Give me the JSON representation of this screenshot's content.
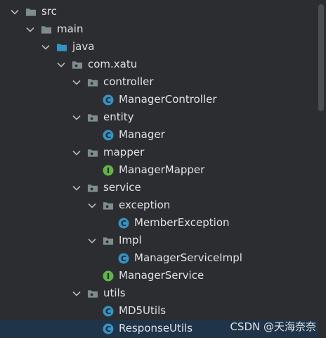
{
  "tree": [
    {
      "depth": 0,
      "kind": "folder",
      "label": "src",
      "expanded": true
    },
    {
      "depth": 1,
      "kind": "folder",
      "label": "main",
      "expanded": true
    },
    {
      "depth": 2,
      "kind": "source-folder",
      "label": "java",
      "expanded": true
    },
    {
      "depth": 3,
      "kind": "package",
      "label": "com.xatu",
      "expanded": true
    },
    {
      "depth": 4,
      "kind": "package",
      "label": "controller",
      "expanded": true
    },
    {
      "depth": 5,
      "kind": "class",
      "label": "ManagerController"
    },
    {
      "depth": 4,
      "kind": "package",
      "label": "entity",
      "expanded": true
    },
    {
      "depth": 5,
      "kind": "class",
      "label": "Manager"
    },
    {
      "depth": 4,
      "kind": "package",
      "label": "mapper",
      "expanded": true
    },
    {
      "depth": 5,
      "kind": "interface",
      "label": "ManagerMapper"
    },
    {
      "depth": 4,
      "kind": "package",
      "label": "service",
      "expanded": true
    },
    {
      "depth": 5,
      "kind": "package",
      "label": "exception",
      "expanded": true
    },
    {
      "depth": 6,
      "kind": "class",
      "label": "MemberException"
    },
    {
      "depth": 5,
      "kind": "package",
      "label": "Impl",
      "expanded": true
    },
    {
      "depth": 6,
      "kind": "class",
      "label": "ManagerServiceImpl"
    },
    {
      "depth": 5,
      "kind": "interface",
      "label": "ManagerService"
    },
    {
      "depth": 4,
      "kind": "package",
      "label": "utils",
      "expanded": true
    },
    {
      "depth": 5,
      "kind": "class",
      "label": "MD5Utils"
    },
    {
      "depth": 5,
      "kind": "class",
      "label": "ResponseUtils",
      "highlight": true
    }
  ],
  "watermark": "CSDN @天海奈奈",
  "colors": {
    "background": "#2b2d30",
    "text": "#dfe1e5",
    "folder": "#7f8b91",
    "source_folder": "#3592c4",
    "class_icon": "#3592c4",
    "interface_icon": "#62b543",
    "selection": "#1f3448"
  }
}
